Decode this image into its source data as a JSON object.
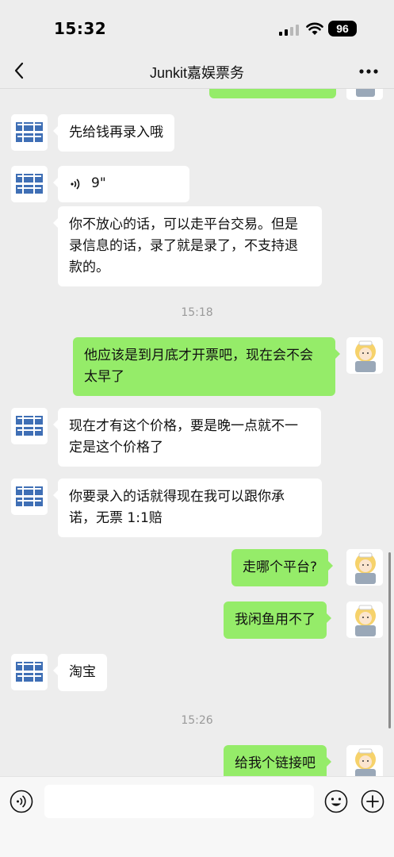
{
  "status_bar": {
    "time": "15:32",
    "battery": "96"
  },
  "nav": {
    "title": "Junkit嘉娱票务"
  },
  "messages": [
    {
      "side": "left",
      "text": "先给钱再录入哦"
    },
    {
      "side": "left",
      "type": "voice",
      "duration": "9\""
    },
    {
      "side": "left",
      "text": "你不放心的话，可以走平台交易。但是录信息的话，录了就是录了，不支持退款的。"
    },
    {
      "type": "time",
      "text": "15:18"
    },
    {
      "side": "right",
      "text": "他应该是到月底才开票吧，现在会不会太早了"
    },
    {
      "side": "left",
      "text": "现在才有这个价格，要是晚一点就不一定是这个价格了"
    },
    {
      "side": "left",
      "text": "你要录入的话就得现在我可以跟你承诺，无票 1:1赔"
    },
    {
      "side": "right",
      "text": "走哪个平台?"
    },
    {
      "side": "right",
      "text": "我闲鱼用不了"
    },
    {
      "side": "left",
      "text": "淘宝"
    },
    {
      "type": "time",
      "text": "15:26"
    },
    {
      "side": "right",
      "text": "给我个链接吧"
    }
  ],
  "input": {
    "placeholder": ""
  },
  "colors": {
    "background": "#ededed",
    "bubble_right": "#95ec69",
    "bubble_left": "#ffffff"
  },
  "icons": {
    "avatar_left": "jiayu-logo-avatar",
    "avatar_right": "anime-girl-avatar"
  }
}
